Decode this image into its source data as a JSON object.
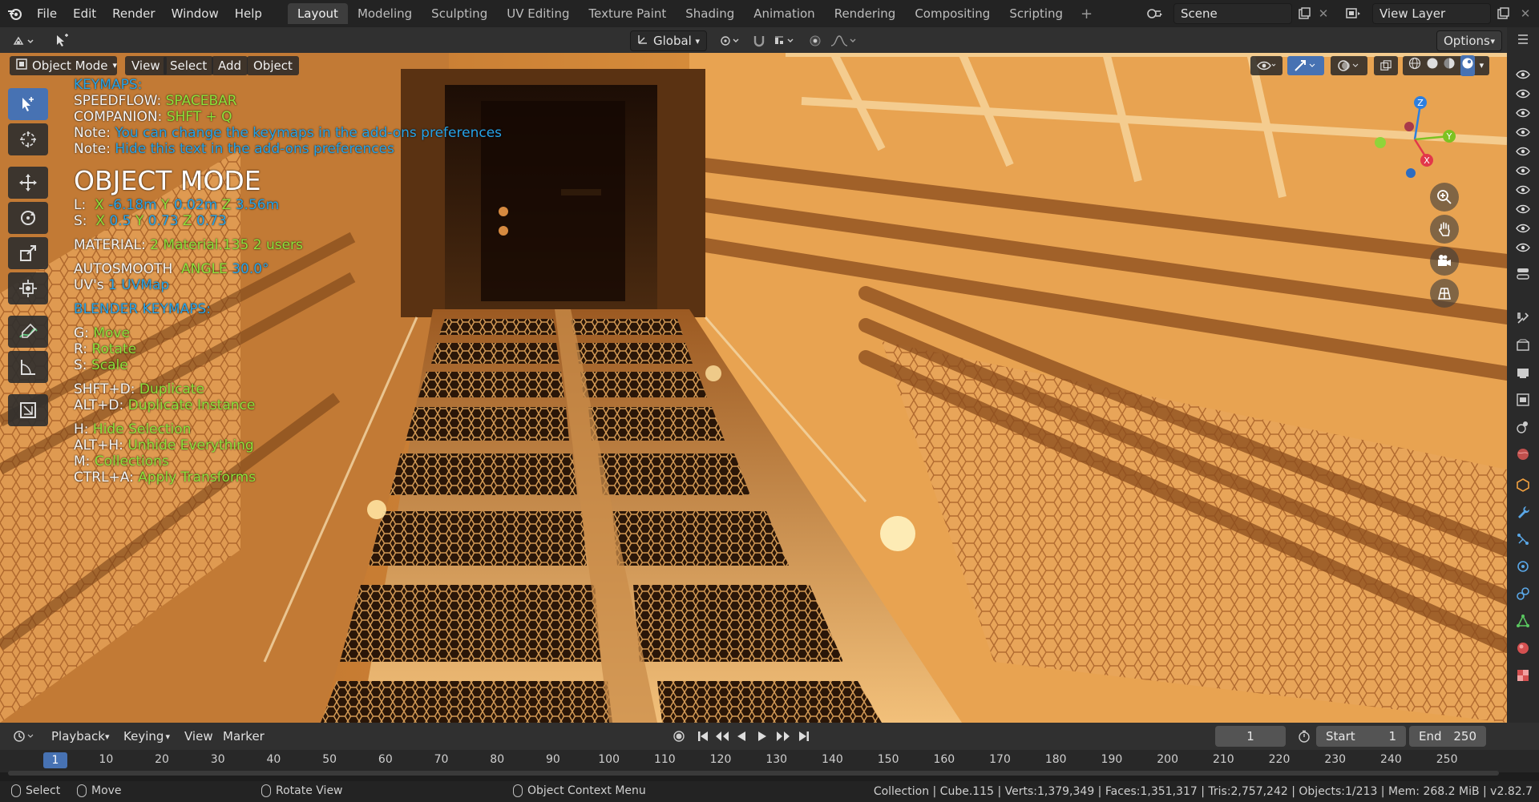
{
  "menu": [
    "File",
    "Edit",
    "Render",
    "Window",
    "Help"
  ],
  "workspaces": [
    "Layout",
    "Modeling",
    "Sculpting",
    "UV Editing",
    "Texture Paint",
    "Shading",
    "Animation",
    "Rendering",
    "Compositing",
    "Scripting"
  ],
  "active_workspace": "Layout",
  "scene": {
    "label": "Scene"
  },
  "view_layer": {
    "label": "View Layer"
  },
  "header": {
    "transform_orientation": "Global",
    "options": "Options"
  },
  "viewport_header": {
    "mode": "Object Mode",
    "view": "View",
    "select": "Select",
    "add": "Add",
    "object": "Object"
  },
  "overlay": {
    "keymaps_title": "KEYMAPS:",
    "speedflow_label": "SPEEDFLOW:",
    "speedflow_key": "SPACEBAR",
    "companion_label": "COMPANION:",
    "companion_key": "SHFT + Q",
    "note_label": "Note:",
    "note1": "You can change the keymaps in the add-ons preferences",
    "note2": "Hide this text in the add-ons preferences",
    "mode_title": "OBJECT MODE",
    "loc_label": "L:",
    "loc_x_label": "X",
    "loc_x": "-6.18m",
    "loc_y_label": "Y",
    "loc_y": "0.02m",
    "loc_z_label": "Z",
    "loc_z": "3.56m",
    "scale_label": "S:",
    "scale_x_label": "X",
    "scale_x": "0.5",
    "scale_y_label": "Y",
    "scale_y": "0.73",
    "scale_z_label": "Z",
    "scale_z": "0.73",
    "material_label": "MATERIAL:",
    "material_count": "2",
    "material_name": "Material.135",
    "material_users": "2 users",
    "autosmooth_label": "AUTOSMOOTH",
    "angle_label": "ANGLE",
    "angle_value": "30.0°",
    "uv_label": "UV's",
    "uv_value": "1 UVMap",
    "blender_keymaps": "BLENDER KEYMAPS:",
    "g_key": "G:",
    "g_action": "Move",
    "r_key": "R:",
    "r_action": "Rotate",
    "s_key": "S:",
    "s_action": "Scale",
    "shftd_key": "SHFT+D:",
    "shftd_action": "Duplicate",
    "altd_key": "ALT+D:",
    "altd_action": "Duplicate Instance",
    "h_key": "H:",
    "h_action": "Hide Selection",
    "alth_key": "ALT+H:",
    "alth_action": "Unhide Everything",
    "m_key": "M:",
    "m_action": "Collections",
    "ctrla_key": "CTRL+A:",
    "ctrla_action": "Apply Transforms"
  },
  "gizmo": {
    "z": "Z",
    "y": "Y",
    "x": "X"
  },
  "timeline": {
    "playback": "Playback",
    "keying": "Keying",
    "view": "View",
    "marker": "Marker",
    "current_frame": "1",
    "start_label": "Start",
    "start_value": "1",
    "end_label": "End",
    "end_value": "250",
    "ruler_current": "1",
    "ticks": [
      "10",
      "20",
      "30",
      "40",
      "50",
      "60",
      "70",
      "80",
      "90",
      "100",
      "110",
      "120",
      "130",
      "140",
      "150",
      "160",
      "170",
      "180",
      "190",
      "200",
      "210",
      "220",
      "230",
      "240",
      "250"
    ]
  },
  "status": {
    "select": "Select",
    "move": "Move",
    "rotate_view": "Rotate View",
    "context_menu": "Object Context Menu",
    "stats": "Collection | Cube.115 | Verts:1,379,349 | Faces:1,351,317 | Tris:2,757,242 | Objects:1/213 | Mem: 268.2 MiB | v2.82.7"
  },
  "colors": {
    "accent": "#4772b3",
    "overlay_blue": "#26a3e8",
    "overlay_green": "#8de23a",
    "axis_x": "#e2374a",
    "axis_y": "#7dc221",
    "axis_z": "#2d7fe0"
  }
}
